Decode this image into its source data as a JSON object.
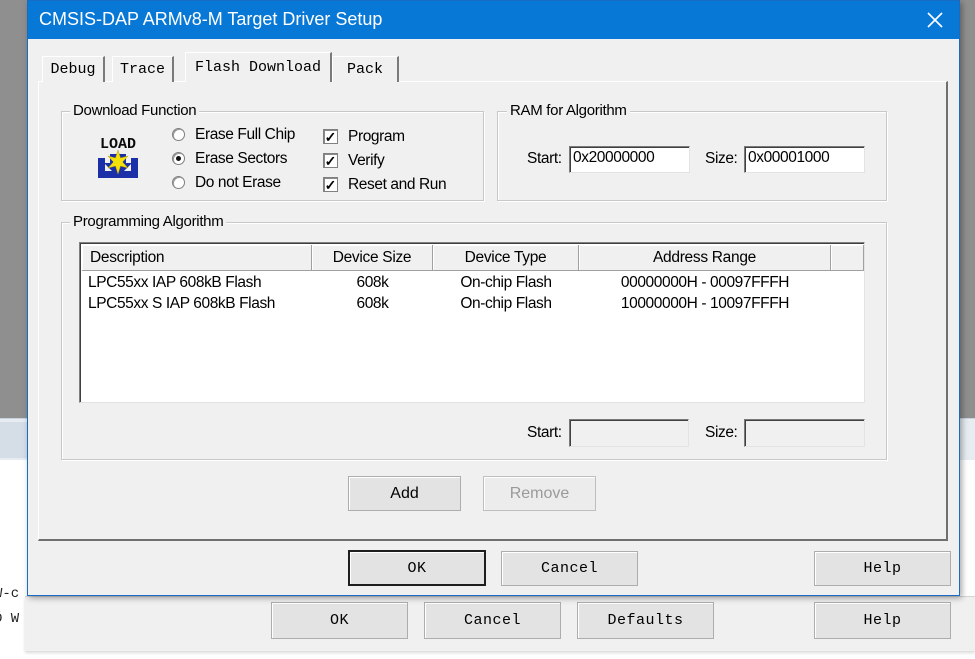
{
  "dialog": {
    "title": "CMSIS-DAP ARMv8-M Target Driver Setup",
    "close_icon": "close-icon",
    "tabs": [
      {
        "label": "Debug",
        "active": false
      },
      {
        "label": "Trace",
        "active": false
      },
      {
        "label": "Flash Download",
        "active": true
      },
      {
        "label": "Pack",
        "active": false
      }
    ],
    "download_function": {
      "legend": "Download Function",
      "icon": "load-icon",
      "icon_text": "LOAD",
      "radios": [
        {
          "label": "Erase Full Chip",
          "selected": false
        },
        {
          "label": "Erase Sectors",
          "selected": true
        },
        {
          "label": "Do not Erase",
          "selected": false
        }
      ],
      "checks": [
        {
          "label": "Program",
          "checked": true
        },
        {
          "label": "Verify",
          "checked": true
        },
        {
          "label": "Reset and Run",
          "checked": true
        }
      ],
      "check_glyph": "✓"
    },
    "ram": {
      "legend": "RAM for Algorithm",
      "start_label": "Start:",
      "start_value": "0x20000000",
      "size_label": "Size:",
      "size_value": "0x00001000"
    },
    "algorithm": {
      "legend": "Programming Algorithm",
      "columns": [
        "Description",
        "Device Size",
        "Device Type",
        "Address Range"
      ],
      "rows": [
        [
          "LPC55xx IAP 608kB Flash",
          "608k",
          "On-chip Flash",
          "00000000H - 00097FFFH"
        ],
        [
          "LPC55xx S IAP 608kB Flash",
          "608k",
          "On-chip Flash",
          "10000000H - 10097FFFH"
        ]
      ],
      "start_label": "Start:",
      "start_value": "",
      "size_label": "Size:",
      "size_value": ""
    },
    "add_label": "Add",
    "remove_label": "Remove",
    "ok_label": "OK",
    "cancel_label": "Cancel",
    "help_label": "Help"
  },
  "background": {
    "text_line1": "W-c",
    "text_line2": "D W",
    "ok_label": "OK",
    "cancel_label": "Cancel",
    "defaults_label": "Defaults",
    "help_label": "Help"
  }
}
